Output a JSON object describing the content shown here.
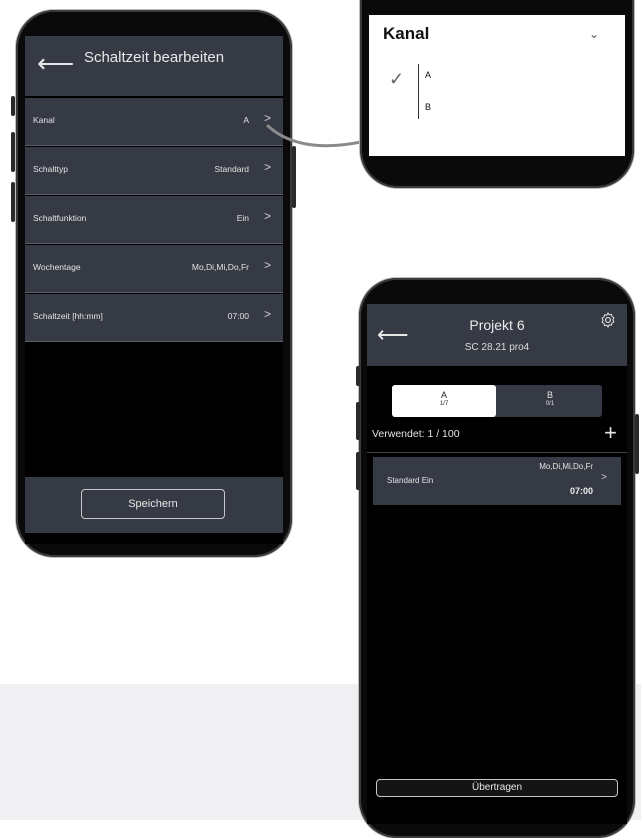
{
  "screen1": {
    "title": "Schaltzeit bearbeiten",
    "back_icon": "back-arrow-icon",
    "rows": [
      {
        "label": "Kanal",
        "value": "A"
      },
      {
        "label": "Schalttyp",
        "value": "Standard"
      },
      {
        "label": "Schaltfunktion",
        "value": "Ein"
      },
      {
        "label": "Wochentage",
        "value": "Mo,Di,Mi,Do,Fr"
      },
      {
        "label": "Schaltzeit  [hh:mm]",
        "value": "07:00"
      }
    ],
    "chevron": ">",
    "save_label": "Speichern"
  },
  "dropdown": {
    "title": "Kanal",
    "caret": "⌄",
    "check": "✓",
    "options": [
      "A",
      "B"
    ],
    "selected": "A"
  },
  "screen3": {
    "title": "Projekt 6",
    "subtitle": "SC 28.21 pro4",
    "tabs": [
      {
        "label": "A",
        "count": "1/7",
        "active": true
      },
      {
        "label": "B",
        "count": "0/1",
        "active": false
      }
    ],
    "used_text": "Verwendet: 1 / 100",
    "add_symbol": "+",
    "entry": {
      "days": "Mo,Di,Mi,Do,Fr",
      "type": "Standard  Ein",
      "time": "07:00",
      "chevron": ">"
    },
    "transfer_label": "Übertragen"
  },
  "colors": {
    "panel": "#353a44",
    "screen": "#000000",
    "text": "#e4e4e4",
    "arrow": "#8a8a8a"
  }
}
